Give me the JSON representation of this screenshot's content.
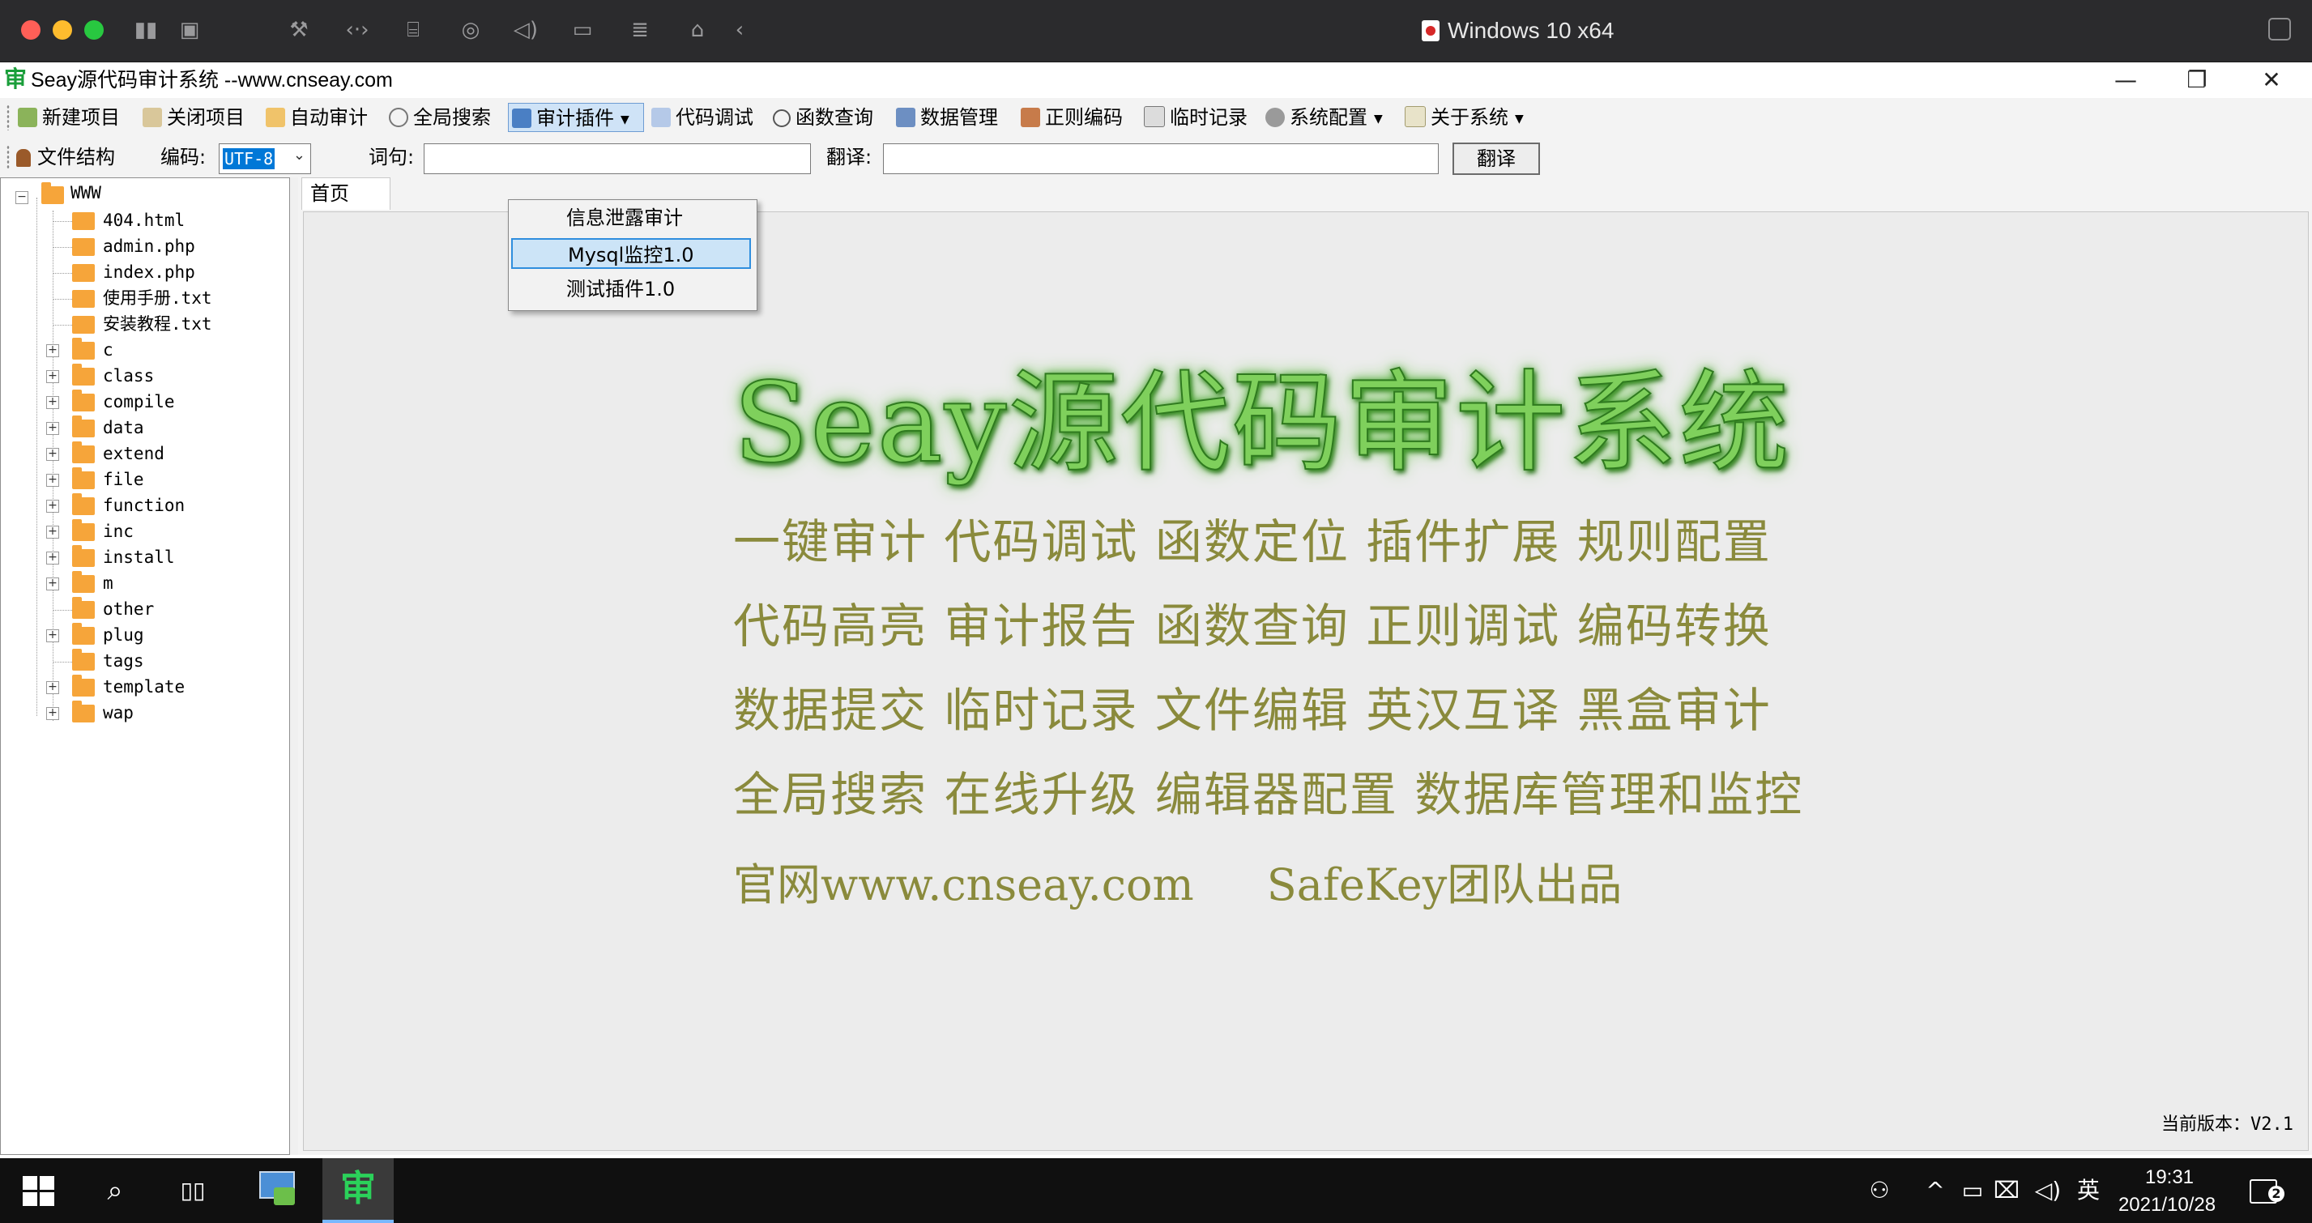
{
  "vm": {
    "title": "Windows 10 x64"
  },
  "app": {
    "logo_glyph": "审",
    "title": "Seay源代码审计系统  --www.cnseay.com",
    "window_controls": {
      "minimize": "—",
      "maximize": "❐",
      "close": "✕"
    }
  },
  "toolbar": {
    "items": [
      {
        "label": "新建项目",
        "icon": "new-project-icon"
      },
      {
        "label": "关闭项目",
        "icon": "close-project-icon"
      },
      {
        "label": "自动审计",
        "icon": "auto-audit-icon"
      },
      {
        "label": "全局搜索",
        "icon": "search-icon"
      },
      {
        "label": "审计插件",
        "icon": "plugin-icon",
        "has_dropdown": true
      },
      {
        "label": "代码调试",
        "icon": "debug-icon"
      },
      {
        "label": "函数查询",
        "icon": "magnifier-icon"
      },
      {
        "label": "数据管理",
        "icon": "database-icon"
      },
      {
        "label": "正则编码",
        "icon": "regex-icon"
      },
      {
        "label": "临时记录",
        "icon": "note-icon"
      },
      {
        "label": "系统配置",
        "icon": "gear-icon",
        "has_dropdown": true
      },
      {
        "label": "关于系统",
        "icon": "info-icon",
        "has_dropdown": true
      }
    ]
  },
  "toolbar2": {
    "file_structure_label": "文件结构",
    "encoding_label": "编码:",
    "encoding_value": "UTF-8",
    "word_label": "词句:",
    "word_value": "",
    "translate_label": "翻译:",
    "translate_value": "",
    "translate_button": "翻译"
  },
  "plugin_menu": {
    "items": [
      {
        "label": "信息泄露审计",
        "selected": false
      },
      {
        "label": "Mysql监控1.0",
        "selected": true
      },
      {
        "label": "测试插件1.0",
        "selected": false
      }
    ]
  },
  "tree": {
    "root": "WWW",
    "files": [
      "404.html",
      "admin.php",
      "index.php",
      "使用手册.txt",
      "安装教程.txt"
    ],
    "folders": [
      {
        "name": "c",
        "expandable": true
      },
      {
        "name": "class",
        "expandable": true
      },
      {
        "name": "compile",
        "expandable": true
      },
      {
        "name": "data",
        "expandable": true
      },
      {
        "name": "extend",
        "expandable": true
      },
      {
        "name": "file",
        "expandable": true
      },
      {
        "name": "function",
        "expandable": true
      },
      {
        "name": "inc",
        "expandable": true
      },
      {
        "name": "install",
        "expandable": true
      },
      {
        "name": "m",
        "expandable": true
      },
      {
        "name": "other",
        "expandable": false
      },
      {
        "name": "plug",
        "expandable": true
      },
      {
        "name": "tags",
        "expandable": false
      },
      {
        "name": "template",
        "expandable": true
      },
      {
        "name": "wap",
        "expandable": true
      }
    ]
  },
  "tabs": [
    {
      "label": "首页"
    }
  ],
  "home": {
    "hero_title": "Seay源代码审计系统",
    "feature_rows": [
      "一键审计  代码调试  函数定位  插件扩展  规则配置",
      "代码高亮  审计报告  函数查询  正则调试  编码转换",
      "数据提交  临时记录  文件编辑  英汉互译  黑盒审计",
      "全局搜索  在线升级  编辑器配置  数据库管理和监控"
    ],
    "site": "官网www.cnseay.com",
    "team": "SafeKey团队出品",
    "version": "当前版本：V2.1"
  },
  "taskbar": {
    "pinned_app_glyph": "审",
    "tray_ime": "英",
    "time": "19:31",
    "date": "2021/10/28",
    "notification_count": "2"
  },
  "colors": {
    "hero_green": "#7fd05c",
    "feature_olive": "#8a8a3c",
    "selection_blue": "#cce4f7",
    "taskbar": "#101010"
  }
}
